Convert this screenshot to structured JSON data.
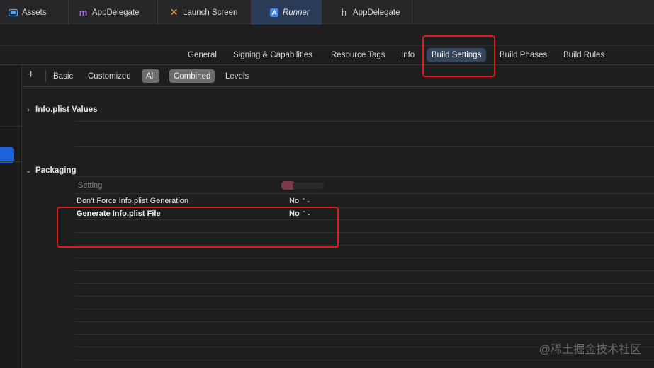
{
  "tabs": [
    {
      "label": "Assets",
      "icon": "assets-icon"
    },
    {
      "label": "AppDelegate",
      "icon": "objc-m-file-icon"
    },
    {
      "label": "Launch Screen",
      "icon": "storyboard-icon"
    },
    {
      "label": "Runner",
      "icon": "project-icon",
      "active": true
    },
    {
      "label": "AppDelegate",
      "icon": "objc-h-file-icon"
    }
  ],
  "settings_tabs": {
    "general": "General",
    "signing": "Signing & Capabilities",
    "resource_tags": "Resource Tags",
    "info": "Info",
    "build_settings": "Build Settings",
    "build_phases": "Build Phases",
    "build_rules": "Build Rules"
  },
  "filters": {
    "add": "+",
    "basic": "Basic",
    "customized": "Customized",
    "all": "All",
    "combined": "Combined",
    "levels": "Levels"
  },
  "sections": {
    "info_plist": {
      "title": "Info.plist Values",
      "chevron": "›"
    },
    "packaging": {
      "title": "Packaging",
      "chevron": "⌄",
      "header": "Setting",
      "rows": [
        {
          "name": "Don't Force Info.plist Generation",
          "value": "No"
        },
        {
          "name": "Generate Info.plist File",
          "value": "No"
        }
      ]
    }
  },
  "stepper_glyph": "⌃⌄",
  "watermark": "@稀土掘金技术社区",
  "colors": {
    "accent": "#1c62d9",
    "selected_tab": "#36465f",
    "annotation_red": "#e0191b"
  }
}
